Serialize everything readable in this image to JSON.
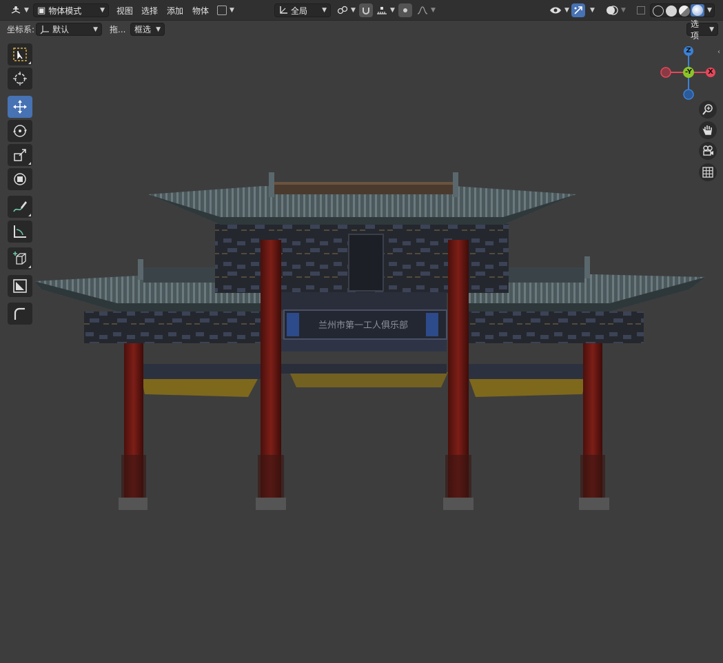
{
  "header": {
    "mode_label": "物体模式",
    "menus": [
      "视图",
      "选择",
      "添加",
      "物体"
    ],
    "transform_orientation": "全局"
  },
  "subheader": {
    "coordinate_label": "坐标系:",
    "coordinate_value": "默认",
    "drag_label": "拖...",
    "drag_value": "框选",
    "options_label": "选项"
  },
  "toolbar": {
    "tools": [
      "select-box",
      "cursor",
      "move",
      "rotate",
      "scale",
      "transform",
      "annotate",
      "measure",
      "add-cube",
      "knife-tool",
      "arc-tool"
    ],
    "active_tool": "move"
  },
  "gizmo": {
    "z_label": "Z",
    "y_label": "-Y",
    "x_label": "X",
    "colors": {
      "x": "#e8465a",
      "y": "#8cc428",
      "z": "#3b82d6"
    }
  },
  "scene": {
    "plaque_text": "兰州市第一工人俱乐部",
    "colors": {
      "roof": "#4c5a5e",
      "pillar": "#7a1c16",
      "beam": "#2a2e3a",
      "gold": "#a88a1a"
    }
  },
  "colors": {
    "accent": "#4772b3",
    "header_bg": "#303030",
    "viewport_bg": "#3d3d3d"
  }
}
